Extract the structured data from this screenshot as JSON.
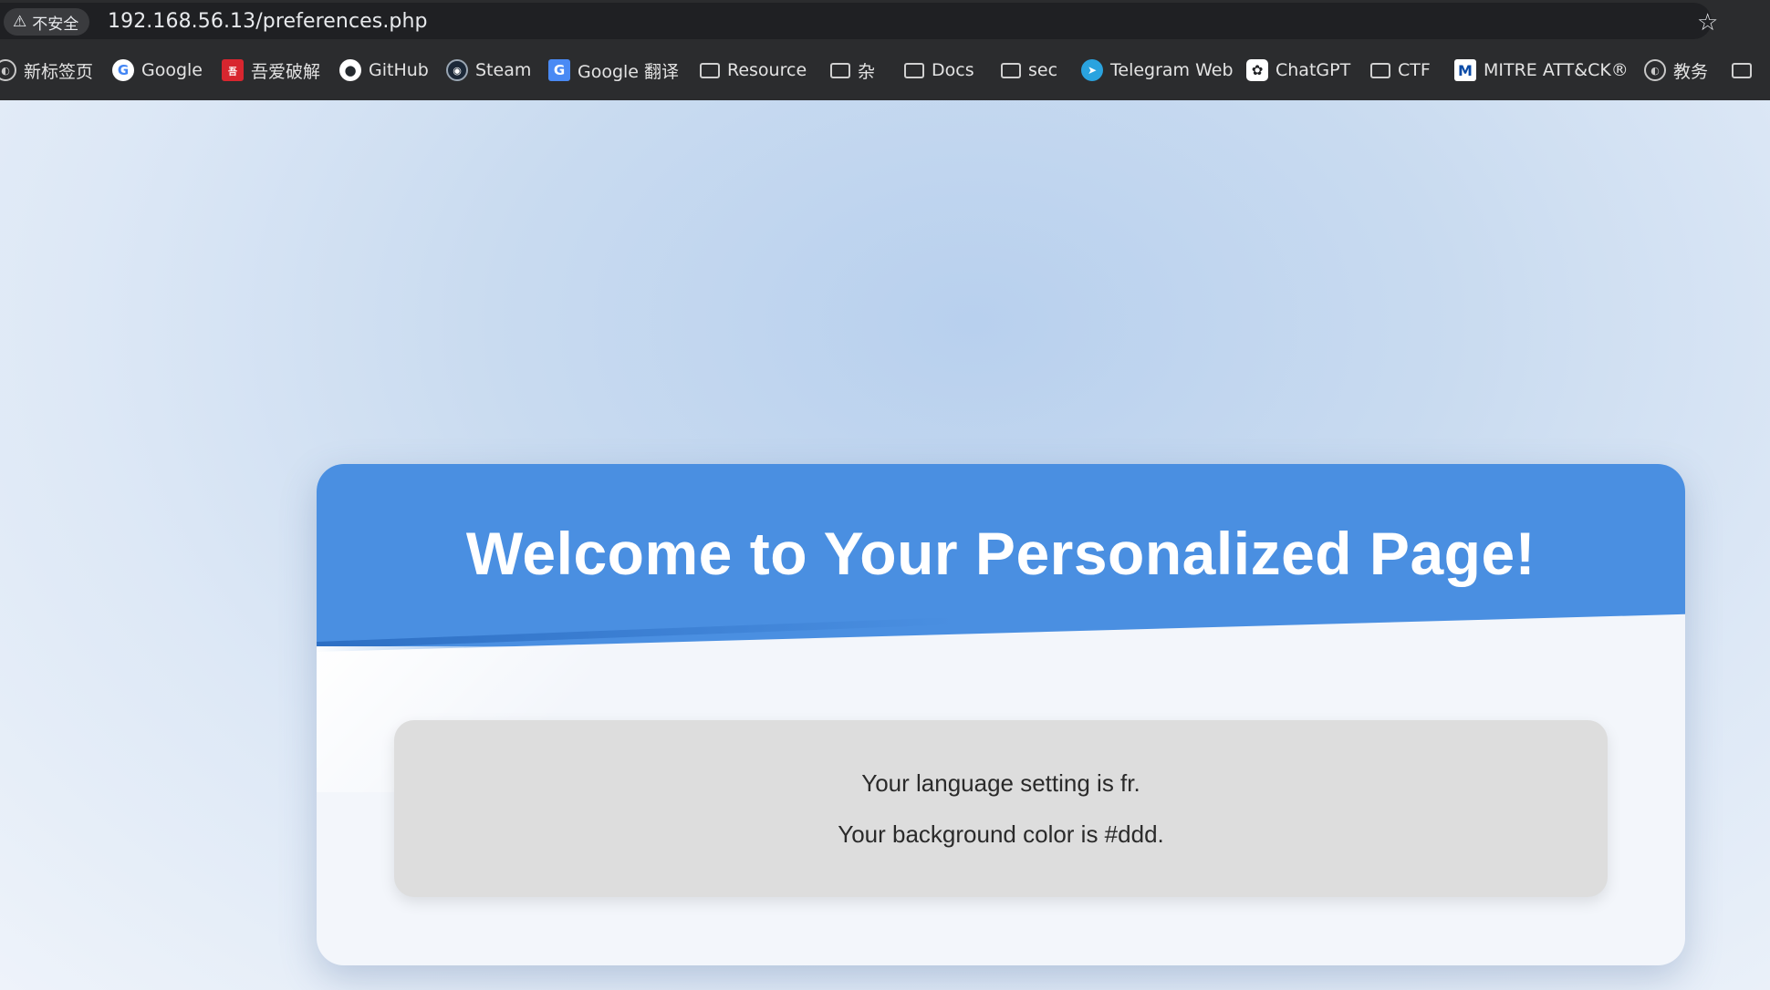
{
  "browser": {
    "security_label": "不安全",
    "url": "192.168.56.13/preferences.php"
  },
  "bookmarks": [
    {
      "label": "新标签页",
      "icon": "globe-icon"
    },
    {
      "label": "Google",
      "icon": "google-icon"
    },
    {
      "label": "吾爱破解",
      "icon": "52pojie-icon"
    },
    {
      "label": "GitHub",
      "icon": "github-icon"
    },
    {
      "label": "Steam",
      "icon": "steam-icon"
    },
    {
      "label": "Google 翻译",
      "icon": "google-translate-icon"
    },
    {
      "label": "Resource",
      "icon": "folder-icon"
    },
    {
      "label": "杂",
      "icon": "folder-icon"
    },
    {
      "label": "Docs",
      "icon": "folder-icon"
    },
    {
      "label": "sec",
      "icon": "folder-icon"
    },
    {
      "label": "Telegram Web",
      "icon": "telegram-icon"
    },
    {
      "label": "ChatGPT",
      "icon": "chatgpt-icon"
    },
    {
      "label": "CTF",
      "icon": "folder-icon"
    },
    {
      "label": "MITRE ATT&CK®",
      "icon": "mitre-icon"
    },
    {
      "label": "教务",
      "icon": "globe-icon"
    },
    {
      "label": "",
      "icon": "folder-icon"
    }
  ],
  "page": {
    "title": "Welcome to Your Personalized Page!",
    "language_line": "Your language setting is fr.",
    "background_line": "Your background color is #ddd."
  },
  "colors": {
    "header_blue": "#4a8fe1",
    "info_box_bg": "#dddddd"
  }
}
